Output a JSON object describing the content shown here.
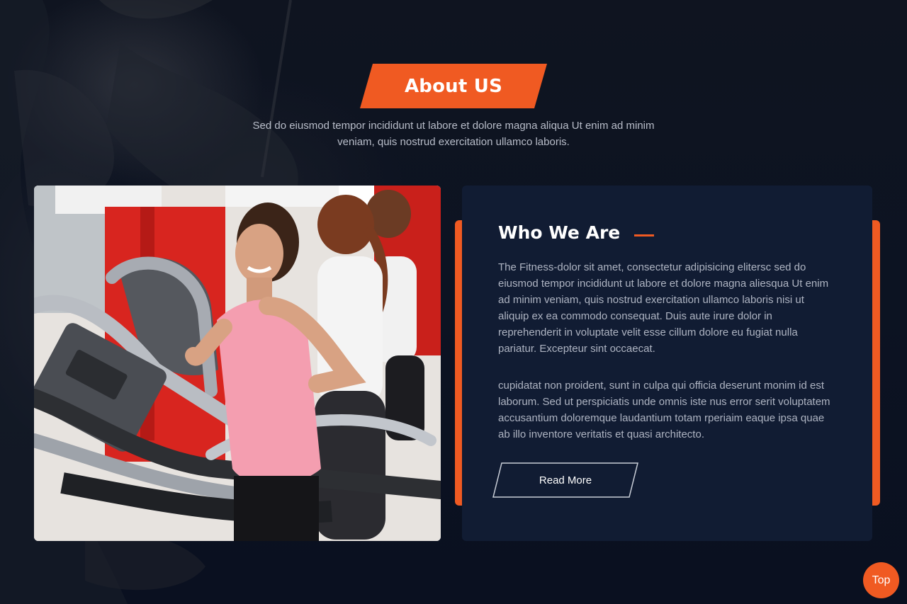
{
  "section": {
    "title": "About US",
    "intro": "Sed do eiusmod tempor incididunt ut labore et dolore magna aliqua Ut enim ad minim veniam, quis nostrud exercitation ullamco laboris."
  },
  "about_card": {
    "title": "Who We Are",
    "paragraph_1": "The Fitness-dolor sit amet, consectetur adipisicing elitersc sed do eiusmod tempor incididunt ut labore et dolore magna aliesqua Ut enim ad minim veniam, quis nostrud exercitation ullamco laboris nisi ut aliquip ex ea commodo consequat. Duis aute irure dolor in reprehenderit in voluptate velit esse cillum dolore eu fugiat nulla pariatur. Excepteur sint occaecat.",
    "paragraph_2": "cupidatat non proident, sunt in culpa qui officia deserunt monim id est laborum. Sed ut perspiciatis unde omnis iste nus error serit voluptatem accusantium doloremque laudantium totam rperiaim eaque ipsa quae ab illo inventore veritatis et quasi architecto.",
    "button_label": "Read More"
  },
  "back_to_top": {
    "label": "Top"
  },
  "colors": {
    "accent": "#f05a22",
    "background": "#0b1220",
    "card": "#111c33"
  },
  "icons": {
    "photo": "treadmill-gym-photo"
  }
}
